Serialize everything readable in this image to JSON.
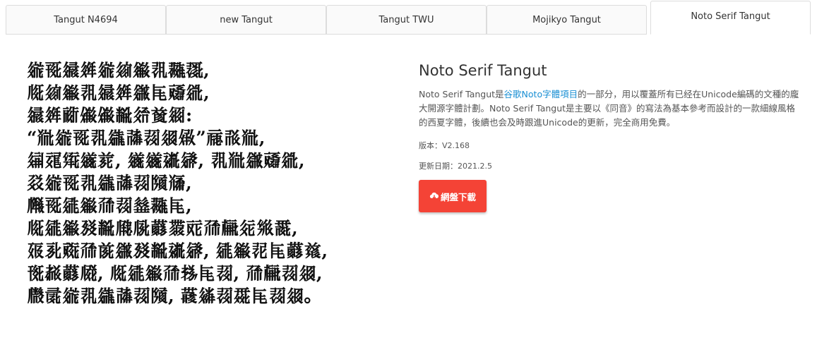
{
  "tabs": [
    {
      "label": "Tangut N4694",
      "active": false
    },
    {
      "label": "new Tangut",
      "active": false
    },
    {
      "label": "Tangut TWU",
      "active": false
    },
    {
      "label": "Mojikyo Tangut",
      "active": false
    },
    {
      "label": "Noto Serif Tangut",
      "active": true
    }
  ],
  "sample": {
    "lines": [
      "𗨁𗀔𗩨𗤶𗨁𗦻𗪞𗕻𗖵𗖰,",
      "𗅉𗦻𗪞𗕻𗩨𗤶𗫡𗹭𗡙𗥦,",
      "𗩨𗤶𗠁𗏹𗏹𘋢𗣷𗒹𗥃:",
      "“𗮅𗨁𗀔𗕻𗪘𗰜𗖌𗤓𗏣”𗄊𗰛𗮅,",
      "𗤾𗶍𗋕𗫂𗐱, 𗫂𗫂𗡶𗨿, 𗕻𗮅𗫡𗡙𗥦,",
      "𗳦𗨁𗀔𗕻𗪘𗰜𗖌𗂧𗮐,",
      "𗆼𗀔𗧓𗪞𗗙𗖌𗶠𗖵𗹭,",
      "𗅉𗧓𗪞𗉡𘋢𗆂𗄯𗝔𗷅𗠇𗗙𗍳𗢵𗊱𗵘,",
      "𗡞𗎘𗡅𗗙𗐯𗫡𗉡𘋢𗡶𗨿, 𗧓𗪞𗕿𗹭𗝔𗒛,",
      "𗍊𗳔𗝔𗆧, 𗅉𗧓𗪞𗗙𗈪𗹭𗖌, 𗗙𗍳𗖌𗤓,",
      "𗆸𗕑𗨁𗕻𗪘𗰜𗖌𗂧, 𗞞𗥫𗖌𗴺𗹭𗖌𗤓。"
    ]
  },
  "info": {
    "title": "Noto Serif Tangut",
    "desc_prefix": "Noto Serif Tangut是",
    "desc_link": "谷歌Noto字體項目",
    "desc_suffix": "的一部分，用以覆蓋所有已经在Unicode編碼的文種的龐大開源字體計劃。Noto Serif Tangut是主要以《同音》的寫法為基本參考而設計的一款細線風格的西夏字體，後續也会及時跟進Unicode的更新，完全商用免費。",
    "version": "版本：V2.168",
    "updated": "更新日期：2021.2.5",
    "download_label": "網盤下載",
    "accent": "#f44336",
    "link_color": "#1a8fd3"
  }
}
